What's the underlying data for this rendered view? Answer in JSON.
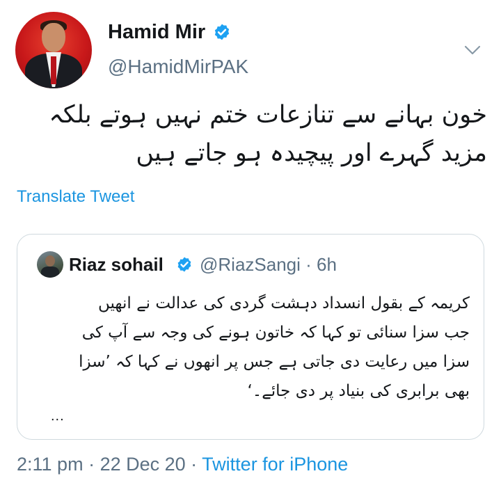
{
  "author": {
    "name": "Hamid Mir",
    "handle": "@HamidMirPAK"
  },
  "tweet": {
    "lines": [
      "خون بہانے سے تنازعات ختم نہیں ہوتے بلکہ",
      "مزید گہرے اور پیچیدہ ہو جاتے ہیں"
    ],
    "translate_label": "Translate Tweet"
  },
  "quoted": {
    "name": "Riaz sohail",
    "handle": "@RiazSangi",
    "time": "· 6h",
    "lines": [
      "کریمہ کے بقول انسداد دہشت گردی کی عدالت نے انھیں",
      "جب سزا سنائی تو کہا کہ خاتون ہونے کی وجہ سے آپ کی",
      "سزا میں رعایت دی جاتی ہے جس پر انھوں نے کہا کہ ’سزا",
      "بھی برابری کی بنیاد پر دی جائے۔‘"
    ],
    "ellipsis": "..."
  },
  "meta": {
    "time": "2:11 pm",
    "separator": " · ",
    "date": "22 Dec 20",
    "source": "Twitter for iPhone"
  },
  "colors": {
    "accent": "#1b95e0",
    "verified": "#1da1f2",
    "muted": "#5b7083",
    "border": "#cfd9de"
  },
  "icons": {
    "verified": "verified-badge-icon",
    "more": "chevron-down-icon"
  }
}
